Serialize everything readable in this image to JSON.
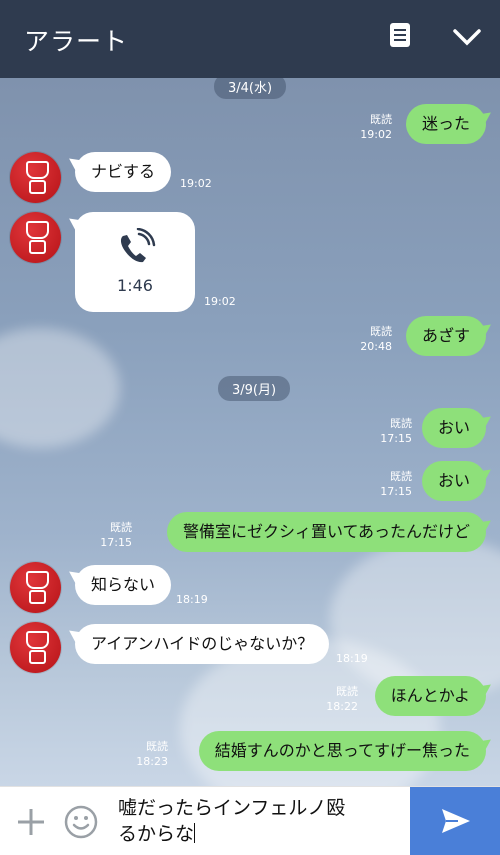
{
  "header": {
    "title": "アラート",
    "icons": [
      "note-icon",
      "chevron-down-icon"
    ]
  },
  "dates": [
    "3/4(水)",
    "3/9(月)"
  ],
  "messages": [
    {
      "side": "right",
      "text": "迷った",
      "read": "既読",
      "time": "19:02"
    },
    {
      "side": "left",
      "text": "ナビする",
      "time": "19:02"
    },
    {
      "side": "left",
      "type": "call",
      "duration": "1:46",
      "time": "19:02"
    },
    {
      "side": "right",
      "text": "あざす",
      "read": "既読",
      "time": "20:48"
    },
    {
      "side": "right",
      "text": "おい",
      "read": "既読",
      "time": "17:15"
    },
    {
      "side": "right",
      "text": "おい",
      "read": "既読",
      "time": "17:15"
    },
    {
      "side": "right",
      "text": "警備室にゼクシィ置いてあったんだけど",
      "read": "既読",
      "time": "17:15"
    },
    {
      "side": "left",
      "text": "知らない",
      "time": "18:19"
    },
    {
      "side": "left",
      "text": "アイアンハイドのじゃないか？",
      "time": "18:19"
    },
    {
      "side": "right",
      "text": "ほんとかよ",
      "read": "既読",
      "time": "18:22"
    },
    {
      "side": "right",
      "text": "結婚すんのかと思ってすげー焦った",
      "read": "既読",
      "time": "18:23"
    }
  ],
  "composer": {
    "text_line1": "嘘だったらインフェルノ殴",
    "text_line2": "るからな",
    "icons": [
      "plus-icon",
      "emoji-icon",
      "send-icon"
    ]
  },
  "colors": {
    "header_bg": "#2f3b4f",
    "my_bubble": "#8ee07a",
    "send_bg": "#4a7fd8"
  }
}
